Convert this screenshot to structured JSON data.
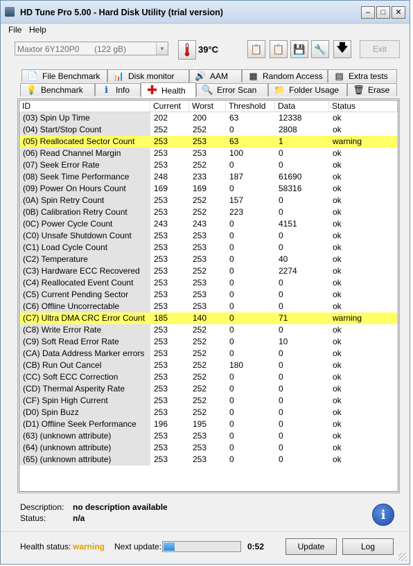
{
  "window": {
    "title": "HD Tune Pro 5.00 - Hard Disk Utility (trial version)"
  },
  "menu": [
    {
      "label": "File"
    },
    {
      "label": "Help"
    }
  ],
  "toolbar": {
    "drive_name": "Maxtor  6Y120P0",
    "drive_size": "(122 gB)",
    "temperature": "39°C",
    "exit_label": "Exit"
  },
  "tabs": {
    "top": [
      {
        "label": "File Benchmark",
        "icon": "file-benchmark-icon"
      },
      {
        "label": "Disk monitor",
        "icon": "disk-monitor-icon"
      },
      {
        "label": "AAM",
        "icon": "speaker-icon"
      },
      {
        "label": "Random Access",
        "icon": "random-access-icon"
      },
      {
        "label": "Extra tests",
        "icon": "extra-tests-icon"
      }
    ],
    "bottom": [
      {
        "label": "Benchmark",
        "icon": "lightbulb-icon"
      },
      {
        "label": "Info",
        "icon": "info-icon"
      },
      {
        "label": "Health",
        "icon": "health-cross-icon"
      },
      {
        "label": "Error Scan",
        "icon": "magnifier-icon"
      },
      {
        "label": "Folder Usage",
        "icon": "folder-icon"
      },
      {
        "label": "Erase",
        "icon": "trash-icon"
      }
    ],
    "active": "Health"
  },
  "table": {
    "columns": [
      "ID",
      "Current",
      "Worst",
      "Threshold",
      "Data",
      "Status"
    ],
    "rows": [
      [
        "(03) Spin Up Time",
        "202",
        "200",
        "63",
        "12338",
        "ok"
      ],
      [
        "(04) Start/Stop Count",
        "252",
        "252",
        "0",
        "2808",
        "ok"
      ],
      [
        "(05) Reallocated Sector Count",
        "253",
        "253",
        "63",
        "1",
        "warning"
      ],
      [
        "(06) Read Channel Margin",
        "253",
        "253",
        "100",
        "0",
        "ok"
      ],
      [
        "(07) Seek Error Rate",
        "253",
        "252",
        "0",
        "0",
        "ok"
      ],
      [
        "(08) Seek Time Performance",
        "248",
        "233",
        "187",
        "61690",
        "ok"
      ],
      [
        "(09) Power On Hours Count",
        "169",
        "169",
        "0",
        "58316",
        "ok"
      ],
      [
        "(0A) Spin Retry Count",
        "253",
        "252",
        "157",
        "0",
        "ok"
      ],
      [
        "(0B) Calibration Retry Count",
        "253",
        "252",
        "223",
        "0",
        "ok"
      ],
      [
        "(0C) Power Cycle Count",
        "243",
        "243",
        "0",
        "4151",
        "ok"
      ],
      [
        "(C0) Unsafe Shutdown Count",
        "253",
        "253",
        "0",
        "0",
        "ok"
      ],
      [
        "(C1) Load Cycle Count",
        "253",
        "253",
        "0",
        "0",
        "ok"
      ],
      [
        "(C2) Temperature",
        "253",
        "253",
        "0",
        "40",
        "ok"
      ],
      [
        "(C3) Hardware ECC Recovered",
        "253",
        "252",
        "0",
        "2274",
        "ok"
      ],
      [
        "(C4) Reallocated Event Count",
        "253",
        "253",
        "0",
        "0",
        "ok"
      ],
      [
        "(C5) Current Pending Sector",
        "253",
        "253",
        "0",
        "0",
        "ok"
      ],
      [
        "(C6) Offline Uncorrectable",
        "253",
        "253",
        "0",
        "0",
        "ok"
      ],
      [
        "(C7) Ultra DMA CRC Error Count",
        "185",
        "140",
        "0",
        "71",
        "warning"
      ],
      [
        "(C8) Write Error Rate",
        "253",
        "252",
        "0",
        "0",
        "ok"
      ],
      [
        "(C9) Soft Read Error Rate",
        "253",
        "252",
        "0",
        "10",
        "ok"
      ],
      [
        "(CA) Data Address Marker errors",
        "253",
        "252",
        "0",
        "0",
        "ok"
      ],
      [
        "(CB) Run Out Cancel",
        "253",
        "252",
        "180",
        "0",
        "ok"
      ],
      [
        "(CC) Soft ECC Correction",
        "253",
        "252",
        "0",
        "0",
        "ok"
      ],
      [
        "(CD) Thermal Asperity Rate",
        "253",
        "252",
        "0",
        "0",
        "ok"
      ],
      [
        "(CF) Spin High Current",
        "253",
        "252",
        "0",
        "0",
        "ok"
      ],
      [
        "(D0) Spin Buzz",
        "253",
        "252",
        "0",
        "0",
        "ok"
      ],
      [
        "(D1) Offline Seek Performance",
        "196",
        "195",
        "0",
        "0",
        "ok"
      ],
      [
        "(63) (unknown attribute)",
        "253",
        "253",
        "0",
        "0",
        "ok"
      ],
      [
        "(64) (unknown attribute)",
        "253",
        "253",
        "0",
        "0",
        "ok"
      ],
      [
        "(65) (unknown attribute)",
        "253",
        "253",
        "0",
        "0",
        "ok"
      ]
    ]
  },
  "details": {
    "description_label": "Description:",
    "description_value": "no description available",
    "status_label": "Status:",
    "status_value": "n/a"
  },
  "footer": {
    "health_label": "Health status:",
    "health_value": "warning",
    "next_update_label": "Next update:",
    "progress": 0.14,
    "timer": "0:52",
    "update_label": "Update",
    "log_label": "Log"
  },
  "colors": {
    "warning_highlight": "#ffff66",
    "health_warning_text": "#e0a000"
  }
}
